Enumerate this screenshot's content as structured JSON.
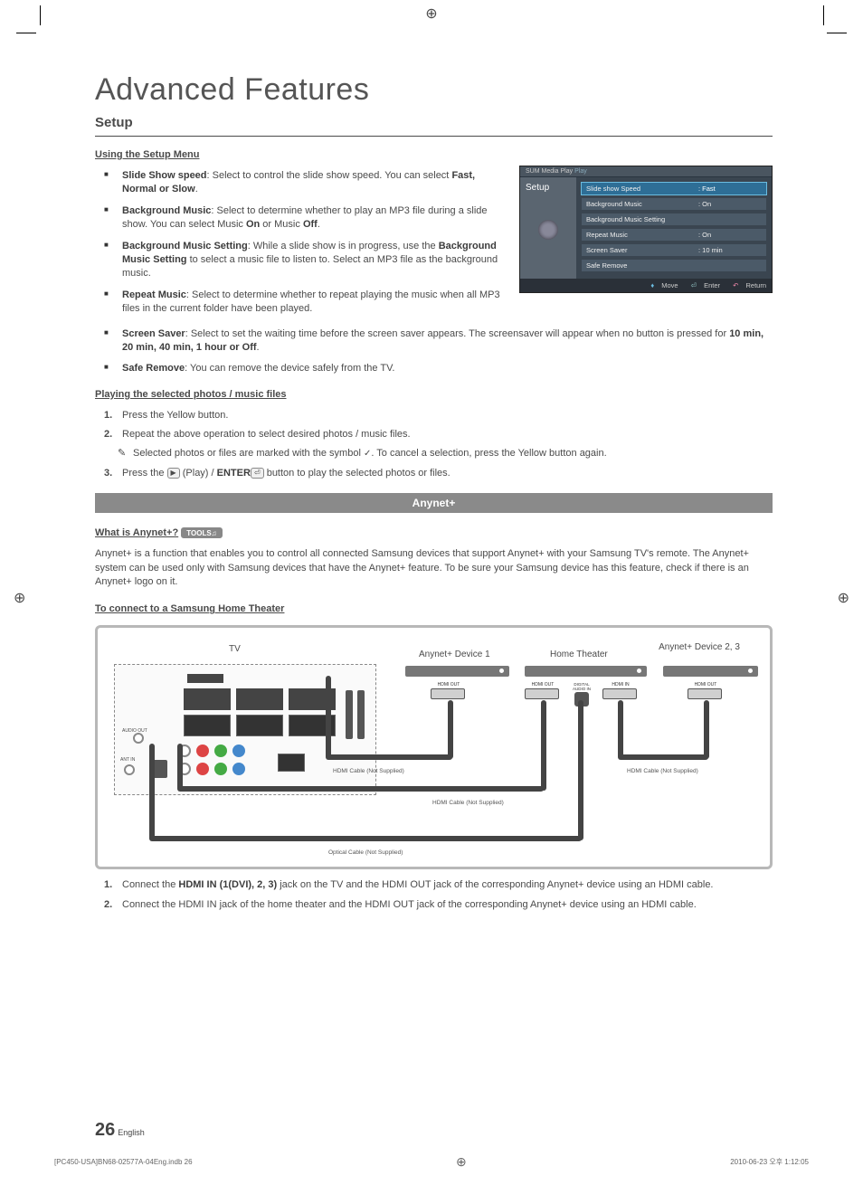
{
  "header": {
    "title": "Advanced Features",
    "section": "Setup"
  },
  "setup_menu": {
    "heading": "Using the Setup Menu",
    "items": [
      {
        "title": "Slide Show speed",
        "body": ": Select to control the slide show speed. You can select ",
        "opts": "Fast, Normal or Slow",
        "tail": "."
      },
      {
        "title": "Background Music",
        "body": ": Select to determine whether to play an MP3 file during a slide show. You can select Music ",
        "opts": "On",
        "mid": " or Music ",
        "opts2": "Off",
        "tail": "."
      },
      {
        "title": "Background Music Setting",
        "body": ": While a slide show is in progress, use the ",
        "opts": "Background Music Setting",
        "mid": " to select a music file to listen to. Select an MP3 file as the background music.",
        "tail": ""
      },
      {
        "title": "Repeat Music",
        "body": ": Select to determine whether to repeat playing the music when all MP3 files in the current folder have been played."
      }
    ],
    "items_full": [
      {
        "title": "Screen Saver",
        "body": ": Select to set the waiting time before the screen saver appears. The screensaver will appear when no button is pressed for ",
        "opts": "10 min, 20 min, 40 min, 1 hour or Off",
        "tail": "."
      },
      {
        "title": "Safe Remove",
        "body": ": You can remove the device safely from the TV."
      }
    ]
  },
  "playing": {
    "heading": "Playing the selected photos / music files",
    "step1": "Press the Yellow button.",
    "step2": "Repeat the above operation to select desired photos / music files.",
    "note": "Selected photos or files are marked with the symbol ",
    "note_tail": ". To cancel a selection, press the Yellow button again.",
    "step3_pre": "Press the ",
    "step3_play": "(Play) / ",
    "step3_enter": "ENTER",
    "step3_post": " button to play the selected photos or files."
  },
  "osd": {
    "mediaplay": "Media Play",
    "left_label": "Setup",
    "rows": [
      {
        "label": "Slide show Speed",
        "value": "Fast",
        "selected": true
      },
      {
        "label": "Background Music",
        "value": "On"
      },
      {
        "label": "Background Music Setting",
        "value": ""
      },
      {
        "label": "Repeat Music",
        "value": "On"
      },
      {
        "label": "Screen Saver",
        "value": "10 min"
      },
      {
        "label": "Safe Remove",
        "value": ""
      }
    ],
    "foot_move": "Move",
    "foot_enter": "Enter",
    "foot_return": "Return"
  },
  "anynet": {
    "banner": "Anynet+",
    "what_head": "What is Anynet+?",
    "tools": "TOOLS",
    "desc": "Anynet+ is a function that enables you to control all connected Samsung devices that support Anynet+ with your Samsung TV's remote. The Anynet+ system can be used only with Samsung devices that have the Anynet+ feature. To be sure your Samsung device has this feature, check if there is an Anynet+ logo on it.",
    "connect_head": "To connect to a Samsung Home Theater"
  },
  "diagram": {
    "tv": "TV",
    "dev1": "Anynet+ Device 1",
    "ht": "Home Theater",
    "dev23": "Anynet+ Device 2, 3",
    "hdmi_out": "HDMI OUT",
    "hdmi_in": "HDMI IN",
    "opt_in": "DIGITAL AUDIO IN",
    "cable_hdmi": "HDMI Cable (Not Supplied)",
    "cable_opt": "Optical Cable (Not Supplied)"
  },
  "steps_bottom": {
    "s1_pre": "Connect the ",
    "s1_bold": "HDMI IN (1(DVI), 2, 3)",
    "s1_post": " jack on the TV and the HDMI OUT jack of the corresponding Anynet+ device using an HDMI cable.",
    "s2": "Connect the HDMI IN jack of the home theater and the HDMI OUT jack of the corresponding Anynet+ device using an HDMI cable."
  },
  "footer": {
    "page_num": "26",
    "lang": "English",
    "doc_left": "[PC450-USA]BN68-02577A-04Eng.indb   26",
    "doc_right": "2010-06-23   오후 1:12:05"
  }
}
